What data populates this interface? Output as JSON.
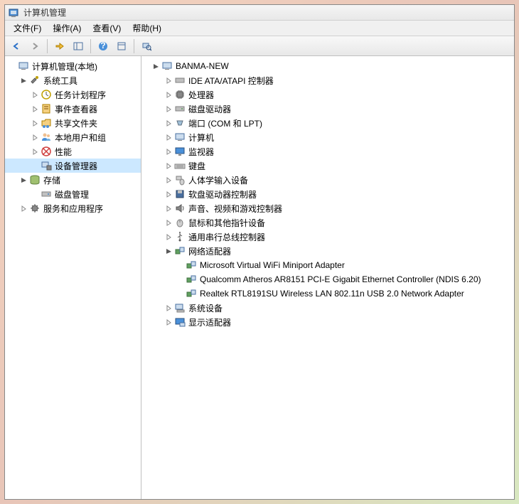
{
  "window": {
    "title": "计算机管理"
  },
  "menu": {
    "file": "文件(F)",
    "action": "操作(A)",
    "view": "查看(V)",
    "help": "帮助(H)"
  },
  "toolbar_icons": {
    "back": "back-icon",
    "forward": "forward-icon",
    "up": "up-icon",
    "show_hide": "show-hide-tree-icon",
    "help": "help-icon",
    "properties": "properties-icon",
    "refresh": "refresh-icon"
  },
  "left_tree": {
    "root": "计算机管理(本地)",
    "system_tools": "系统工具",
    "task_scheduler": "任务计划程序",
    "event_viewer": "事件查看器",
    "shared_folders": "共享文件夹",
    "local_users": "本地用户和组",
    "performance": "性能",
    "device_manager": "设备管理器",
    "storage": "存储",
    "disk_mgmt": "磁盘管理",
    "services_apps": "服务和应用程序"
  },
  "right_tree": {
    "computer": "BANMA-NEW",
    "ide": "IDE ATA/ATAPI 控制器",
    "cpu": "处理器",
    "disk_drives": "磁盘驱动器",
    "ports": "端口 (COM 和 LPT)",
    "computers": "计算机",
    "monitors": "监视器",
    "keyboards": "键盘",
    "hid": "人体学输入设备",
    "floppy": "软盘驱动器控制器",
    "sound": "声音、视频和游戏控制器",
    "mice": "鼠标和其他指针设备",
    "usb": "通用串行总线控制器",
    "network": "网络适配器",
    "net1": "Microsoft Virtual WiFi Miniport Adapter",
    "net2": "Qualcomm Atheros AR8151 PCI-E Gigabit Ethernet Controller (NDIS 6.20)",
    "net3": "Realtek RTL8191SU Wireless LAN 802.11n USB 2.0 Network Adapter",
    "system_devices": "系统设备",
    "display": "显示适配器"
  }
}
